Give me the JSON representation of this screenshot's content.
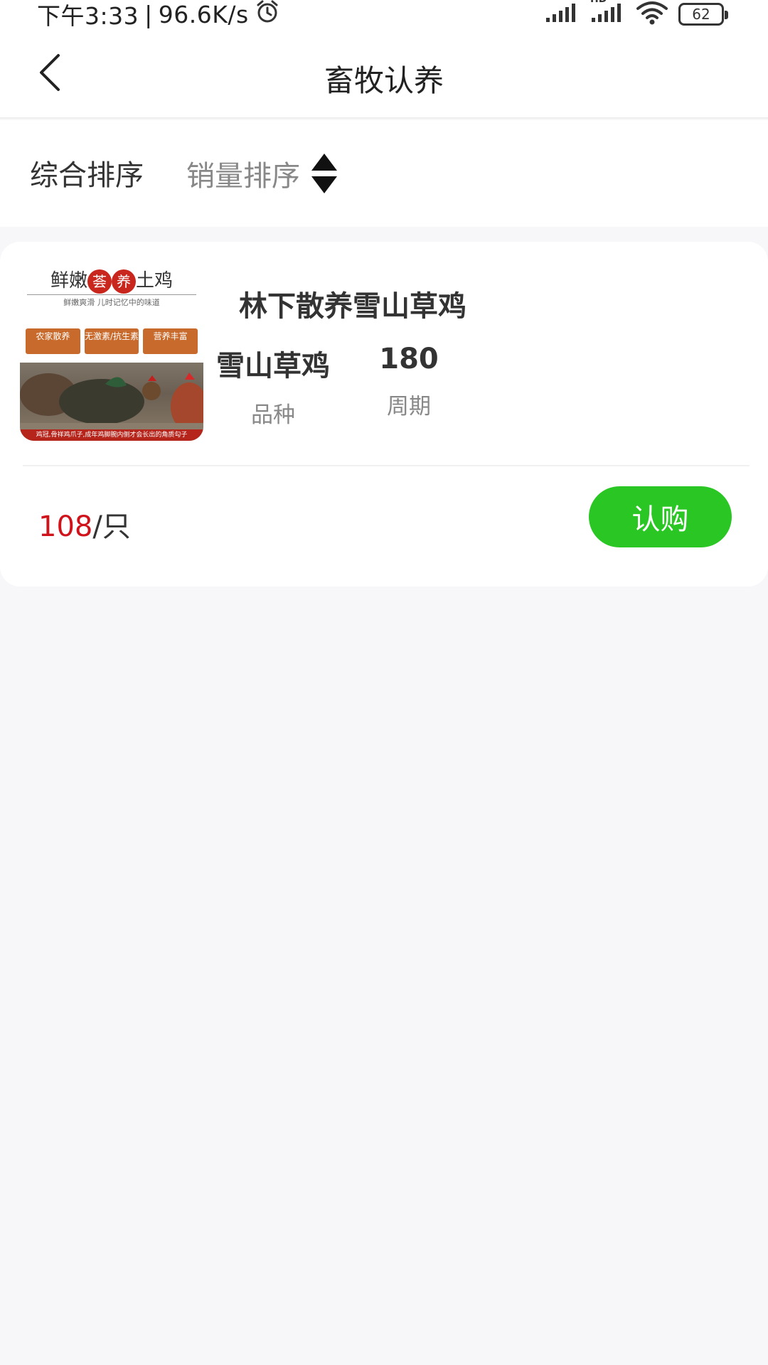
{
  "status_bar": {
    "time": "下午3:33",
    "separator": "|",
    "network_speed": "96.6K/s",
    "network_type": "HD",
    "battery": "62"
  },
  "nav": {
    "title": "畜牧认养"
  },
  "sort": {
    "comprehensive": "综合排序",
    "sales": "销量排序"
  },
  "product": {
    "name": "林下散养雪山草鸡",
    "image_text": {
      "title_left": "鲜嫩",
      "title_seal_1": "荟",
      "title_seal_2": "养",
      "title_right": "土鸡",
      "subtitle": "鲜嫩爽滑 儿时记忆中的味道",
      "tags": [
        "农家散养",
        "无激素/抗生素",
        "营养丰富"
      ],
      "caption": "鸡冠,骨祥鸡爪子,成年鸡脚腕内侧才会长出的角质勾子"
    },
    "breed_value": "雪山草鸡",
    "breed_label": "品种",
    "cycle_value": "180",
    "cycle_label": "周期",
    "price": "108",
    "unit": "/只",
    "buy_label": "认购"
  }
}
